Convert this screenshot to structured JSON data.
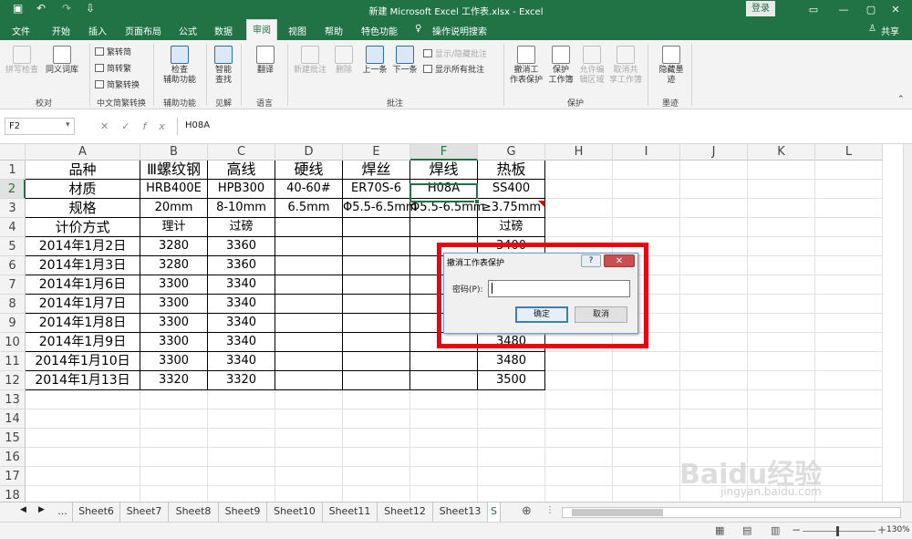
{
  "window": {
    "title": "新建 Microsoft Excel 工作表.xlsx - Excel",
    "login": "登录",
    "min": "—",
    "restore": "▢",
    "close": "✕",
    "share": "共享"
  },
  "quick_access": {
    "save": "▣",
    "undo": "↶",
    "redo": "↷",
    "more": "⇩"
  },
  "tabs": [
    "文件",
    "开始",
    "插入",
    "页面布局",
    "公式",
    "数据",
    "审阅",
    "视图",
    "帮助",
    "特色功能"
  ],
  "tell_me": "操作说明搜索",
  "ribbon": {
    "proofing": {
      "spell": "拼写检查",
      "thesaurus": "同义词库",
      "label": "校对"
    },
    "chinese": {
      "t2s": "繁转简",
      "s2t": "简转繁",
      "conv": "简繁转换",
      "label": "中文简繁转换"
    },
    "access": {
      "check1": "检查",
      "check2": "辅助功能",
      "label": "辅助功能"
    },
    "insights": {
      "l1": "智能",
      "l2": "查找",
      "label": "见解"
    },
    "language": {
      "translate": "翻译",
      "label": "语言"
    },
    "comments": {
      "new": "新建批注",
      "delete": "删除",
      "prev": "上一条",
      "next": "下一条",
      "showhide": "显示/隐藏批注",
      "showall": "显示所有批注",
      "label": "批注"
    },
    "protect": {
      "unprotect1": "撤消工",
      "unprotect2": "作表保护",
      "protectwb1": "保护",
      "protectwb2": "工作簿",
      "allow1": "允许编",
      "allow2": "辑区域",
      "unshare1": "取消共",
      "unshare2": "享工作簿",
      "label": "保护"
    },
    "ink": {
      "l1": "隐藏墨",
      "l2": "迹",
      "label": "墨迹"
    }
  },
  "formula_bar": {
    "namebox": "F2",
    "fx": "fx",
    "value": "H08A"
  },
  "columns": [
    "A",
    "B",
    "C",
    "D",
    "E",
    "F",
    "G",
    "H",
    "I",
    "J",
    "K",
    "L"
  ],
  "rows": [
    "1",
    "2",
    "3",
    "4",
    "5",
    "6",
    "7",
    "8",
    "9",
    "10",
    "11",
    "12",
    "13",
    "14",
    "15",
    "16",
    "17",
    "18"
  ],
  "table": [
    [
      "品种",
      "Ⅲ螺纹钢",
      "高线",
      "硬线",
      "焊丝",
      "焊线",
      "热板"
    ],
    [
      "材质",
      "HRB400E",
      "HPB300",
      "40-60#",
      "ER70S-6",
      "H08A",
      "SS400"
    ],
    [
      "规格",
      "20mm",
      "8-10mm",
      "6.5mm",
      "Φ5.5-6.5mm",
      "Φ5.5-6.5mm",
      "≥3.75mm"
    ],
    [
      "计价方式",
      "理计",
      "过磅",
      "",
      "",
      "",
      "过磅"
    ],
    [
      "2014年1月2日",
      "3280",
      "3360",
      "",
      "",
      "",
      "3400"
    ],
    [
      "2014年1月3日",
      "3280",
      "3360",
      "",
      "",
      "",
      ""
    ],
    [
      "2014年1月6日",
      "3300",
      "3340",
      "",
      "",
      "",
      ""
    ],
    [
      "2014年1月7日",
      "3300",
      "3340",
      "",
      "",
      "",
      ""
    ],
    [
      "2014年1月8日",
      "3300",
      "3340",
      "",
      "",
      "",
      ""
    ],
    [
      "2014年1月9日",
      "3300",
      "3340",
      "",
      "",
      "",
      "3480"
    ],
    [
      "2014年1月10日",
      "3300",
      "3340",
      "",
      "",
      "",
      "3480"
    ],
    [
      "2014年1月13日",
      "3320",
      "3320",
      "",
      "",
      "",
      "3500"
    ]
  ],
  "sheets": [
    "...",
    "Sheet6",
    "Sheet7",
    "Sheet8",
    "Sheet9",
    "Sheet10",
    "Sheet11",
    "Sheet12",
    "Sheet13",
    "S"
  ],
  "zoom": "130%",
  "dialog": {
    "title": "撤消工作表保护",
    "help": "?",
    "close": "✕",
    "password_label": "密码(P):",
    "ok": "确定",
    "cancel": "取消"
  },
  "watermark": {
    "brand": "Baidu经验",
    "url": "jingyan.baidu.com"
  },
  "colors": {
    "excel_green": "#217346",
    "highlight_red": "#f0000f"
  }
}
